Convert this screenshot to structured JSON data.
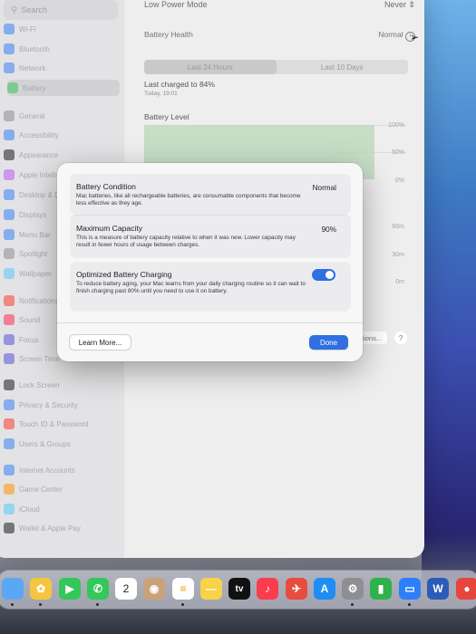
{
  "sidebar": {
    "search_placeholder": "Search",
    "items": [
      {
        "label": "Wi-Fi",
        "icon": "wifi-icon",
        "color": "#3b82f6"
      },
      {
        "label": "Bluetooth",
        "icon": "bluetooth-icon",
        "color": "#3b82f6"
      },
      {
        "label": "Network",
        "icon": "globe-icon",
        "color": "#3b82f6"
      },
      {
        "label": "Battery",
        "icon": "battery-icon",
        "color": "#34c759"
      },
      {
        "label": "General",
        "icon": "gear-icon",
        "color": "#8e8e93"
      },
      {
        "label": "Accessibility",
        "icon": "accessibility-icon",
        "color": "#3b82f6"
      },
      {
        "label": "Appearance",
        "icon": "appearance-icon",
        "color": "#1d1d1f"
      },
      {
        "label": "Apple Intelligence",
        "icon": "apple-intelligence-icon",
        "color": "#bf5af2"
      },
      {
        "label": "Desktop & Dock",
        "icon": "dock-icon",
        "color": "#3b82f6"
      },
      {
        "label": "Displays",
        "icon": "display-icon",
        "color": "#3b82f6"
      },
      {
        "label": "Menu Bar",
        "icon": "menubar-icon",
        "color": "#3b82f6"
      },
      {
        "label": "Spotlight",
        "icon": "spotlight-icon",
        "color": "#8e8e93"
      },
      {
        "label": "Wallpaper",
        "icon": "wallpaper-icon",
        "color": "#5ac8fa"
      },
      {
        "label": "Notifications",
        "icon": "bell-icon",
        "color": "#ff3b30"
      },
      {
        "label": "Sound",
        "icon": "speaker-icon",
        "color": "#ff2d55"
      },
      {
        "label": "Focus",
        "icon": "moon-icon",
        "color": "#5856d6"
      },
      {
        "label": "Screen Time",
        "icon": "hourglass-icon",
        "color": "#5856d6"
      },
      {
        "label": "Lock Screen",
        "icon": "lock-icon",
        "color": "#1d1d1f"
      },
      {
        "label": "Privacy & Security",
        "icon": "hand-icon",
        "color": "#3b82f6"
      },
      {
        "label": "Touch ID & Password",
        "icon": "fingerprint-icon",
        "color": "#ff3b30"
      },
      {
        "label": "Users & Groups",
        "icon": "users-icon",
        "color": "#3b82f6"
      },
      {
        "label": "Internet Accounts",
        "icon": "at-icon",
        "color": "#3b82f6"
      },
      {
        "label": "Game Center",
        "icon": "gamecenter-icon",
        "color": "#ff9500"
      },
      {
        "label": "iCloud",
        "icon": "cloud-icon",
        "color": "#5ac8fa"
      },
      {
        "label": "Wallet & Apple Pay",
        "icon": "wallet-icon",
        "color": "#1d1d1f"
      }
    ]
  },
  "main": {
    "low_power_label": "Low Power Mode",
    "low_power_value": "Never",
    "health_label": "Battery Health",
    "health_value": "Normal",
    "tab_24h": "Last 24 Hours",
    "tab_10d": "Last 10 Days",
    "last_charged": "Last charged to 84%",
    "last_charged_time": "Today, 19:01",
    "battery_level_title": "Battery Level",
    "level_ticks": [
      "100%",
      "50%",
      "0%"
    ],
    "usage_ticks": [
      "60m",
      "30m",
      "0m"
    ],
    "options_label": "Options...",
    "help_label": "?"
  },
  "dialog": {
    "condition_title": "Battery Condition",
    "condition_desc": "Mac batteries, like all rechargeable batteries, are consumable components that become less effective as they age.",
    "condition_value": "Normal",
    "capacity_title": "Maximum Capacity",
    "capacity_desc": "This is a measure of battery capacity relative to when it was new. Lower capacity may result in fewer hours of usage between charges.",
    "capacity_value": "90%",
    "optimized_title": "Optimized Battery Charging",
    "optimized_desc": "To reduce battery aging, your Mac learns from your daily charging routine so it can wait to finish charging past 80% until you need to use it on battery.",
    "optimized_on": true,
    "learn_more": "Learn More...",
    "done": "Done"
  },
  "dock": {
    "calendar_day": "2",
    "tv_label": "tv",
    "apps": [
      "Finder",
      "Photos",
      "FaceTime",
      "Phone",
      "Calendar",
      "Contacts",
      "Reminders",
      "Notes",
      "TV",
      "Music",
      "Testflight",
      "App Store",
      "Settings",
      "Numbers",
      "Keynote",
      "Word",
      "Chrome"
    ]
  },
  "colors": {
    "accent": "#2f6fe0",
    "battery_green": "#34c759"
  }
}
